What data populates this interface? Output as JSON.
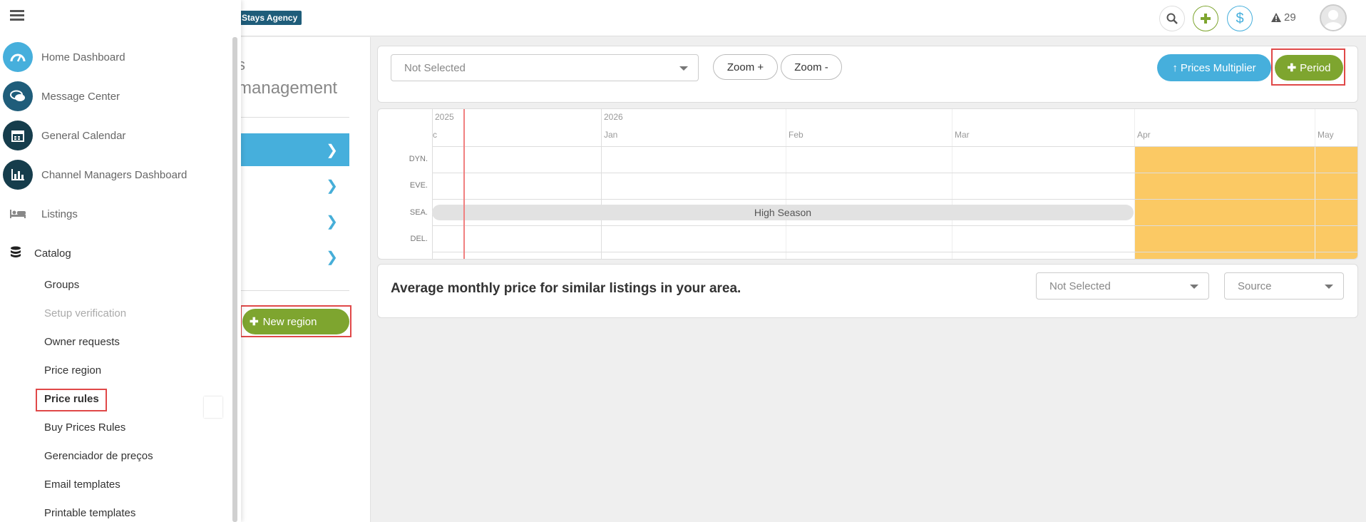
{
  "topbar": {
    "brand": "Stays Agency",
    "alerts_count": "29"
  },
  "sidebar": {
    "nav": [
      {
        "label": "Home Dashboard",
        "icon": "dashboard-gauge-icon",
        "color": "#46afdc"
      },
      {
        "label": "Message Center",
        "icon": "chat-bubbles-icon",
        "color": "#1f5d7a"
      },
      {
        "label": "General Calendar",
        "icon": "calendar-icon",
        "color": "#163d4c"
      },
      {
        "label": "Channel Managers Dashboard",
        "icon": "bar-chart-icon",
        "color": "#163d4c"
      },
      {
        "label": "Listings",
        "icon": "bed-icon"
      },
      {
        "label": "Catalog",
        "icon": "database-icon"
      }
    ],
    "catalog_items": [
      {
        "label": "Groups"
      },
      {
        "label": "Setup verification"
      },
      {
        "label": "Owner requests"
      },
      {
        "label": "Price region"
      },
      {
        "label": "Price rules"
      },
      {
        "label": "Buy Prices Rules"
      },
      {
        "label": "Gerenciador de preços"
      },
      {
        "label": "Email templates"
      },
      {
        "label": "Printable templates"
      }
    ]
  },
  "midpanel": {
    "title_line1": "s",
    "title_line2": "management",
    "new_region_label": "New region"
  },
  "toolbar": {
    "select_value": "Not Selected",
    "zoom_in_label": "Zoom +",
    "zoom_out_label": "Zoom -",
    "prices_multiplier_label": "Prices Multiplier",
    "period_label": "Period"
  },
  "timeline": {
    "years": [
      "2025",
      "2026"
    ],
    "months": [
      "c",
      "Jan",
      "Feb",
      "Mar",
      "Apr",
      "May"
    ],
    "row_labels": [
      "DYN.",
      "EVE.",
      "SEA.",
      "DEL."
    ],
    "season_label": "High Season",
    "highlight_color": "#fbc964"
  },
  "average": {
    "title": "Average monthly price for similar listings in your area.",
    "select1_value": "Not Selected",
    "select2_value": "Source"
  },
  "colors": {
    "accent_blue": "#46afdc",
    "accent_green": "#7ea52f",
    "highlight_red": "#e04848"
  }
}
